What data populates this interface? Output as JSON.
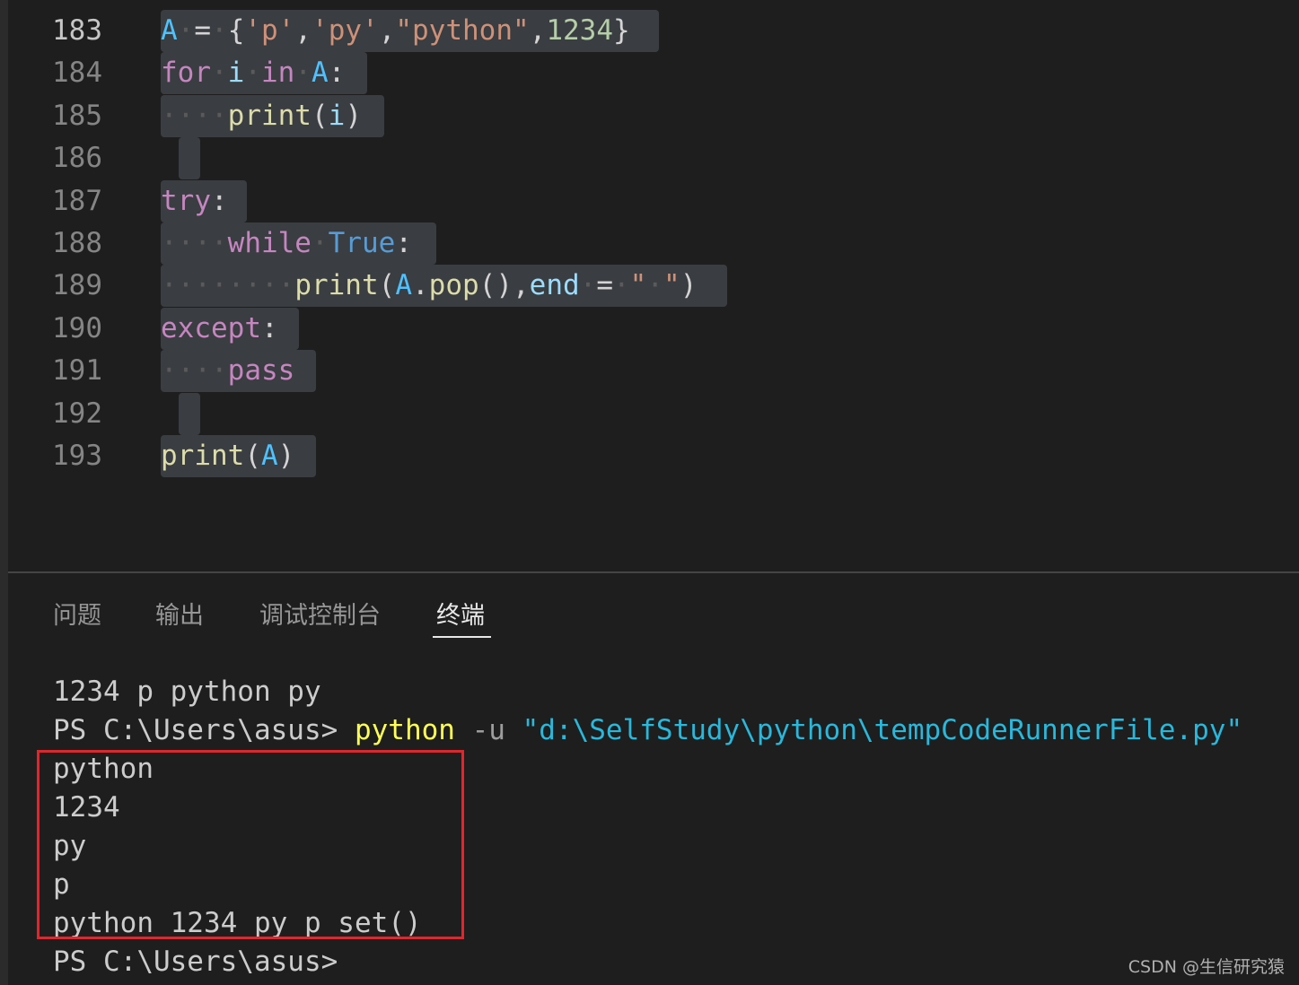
{
  "editor": {
    "line_numbers": [
      "183",
      "184",
      "185",
      "186",
      "187",
      "188",
      "189",
      "190",
      "191",
      "192",
      "193"
    ],
    "lines": [
      [
        [
          "var",
          "A"
        ],
        [
          "ws",
          "·"
        ],
        [
          "op",
          "="
        ],
        [
          "ws",
          "·"
        ],
        [
          "op",
          "{"
        ],
        [
          "str",
          "'p'"
        ],
        [
          "op",
          ","
        ],
        [
          "str",
          "'py'"
        ],
        [
          "op",
          ","
        ],
        [
          "str",
          "\"python\""
        ],
        [
          "op",
          ","
        ],
        [
          "num",
          "1234"
        ],
        [
          "op",
          "}"
        ]
      ],
      [
        [
          "kw",
          "for"
        ],
        [
          "ws",
          "·"
        ],
        [
          "bvar",
          "i"
        ],
        [
          "ws",
          "·"
        ],
        [
          "kw",
          "in"
        ],
        [
          "ws",
          "·"
        ],
        [
          "var",
          "A"
        ],
        [
          "op",
          ":"
        ]
      ],
      [
        [
          "ws",
          "····"
        ],
        [
          "fn",
          "print"
        ],
        [
          "op",
          "("
        ],
        [
          "bvar",
          "i"
        ],
        [
          "op",
          ")"
        ]
      ],
      [],
      [
        [
          "kw",
          "try"
        ],
        [
          "op",
          ":"
        ]
      ],
      [
        [
          "ws",
          "····"
        ],
        [
          "kw",
          "while"
        ],
        [
          "ws",
          "·"
        ],
        [
          "const",
          "True"
        ],
        [
          "op",
          ":"
        ]
      ],
      [
        [
          "ws",
          "········"
        ],
        [
          "fn",
          "print"
        ],
        [
          "op",
          "("
        ],
        [
          "var",
          "A"
        ],
        [
          "op",
          "."
        ],
        [
          "fn",
          "pop"
        ],
        [
          "op",
          "(),"
        ],
        [
          "bvar",
          "end"
        ],
        [
          "ws",
          "·"
        ],
        [
          "op",
          "="
        ],
        [
          "ws",
          "·"
        ],
        [
          "str",
          "\""
        ],
        [
          "ws",
          "·"
        ],
        [
          "str",
          "\""
        ],
        [
          "op",
          ")"
        ]
      ],
      [
        [
          "kw",
          "except"
        ],
        [
          "op",
          ":"
        ]
      ],
      [
        [
          "ws",
          "····"
        ],
        [
          "kw",
          "pass"
        ]
      ],
      [],
      [
        [
          "fn",
          "print"
        ],
        [
          "op",
          "("
        ],
        [
          "var",
          "A"
        ],
        [
          "op",
          ")"
        ]
      ]
    ]
  },
  "panel": {
    "tabs": [
      {
        "label": "问题"
      },
      {
        "label": "输出"
      },
      {
        "label": "调试控制台"
      },
      {
        "label": "终端"
      }
    ],
    "active_tab": "终端"
  },
  "terminal": {
    "line1": "1234 p python py",
    "prompt": "PS C:\\Users\\asus> ",
    "cmd": "python",
    "param": " -u ",
    "path": "\"d:\\SelfStudy\\python\\tempCodeRunnerFile.py\"",
    "output": [
      "python",
      "1234",
      "py",
      "p",
      "python 1234 py p set()"
    ],
    "last_prompt": "PS C:\\Users\\asus>"
  },
  "watermark": "CSDN @生信研究猿"
}
